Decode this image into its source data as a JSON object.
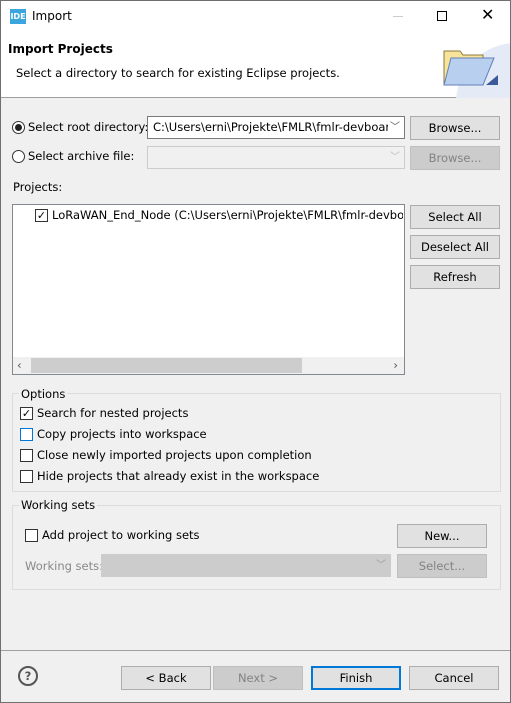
{
  "window": {
    "title": "Import",
    "app_icon": "IDE"
  },
  "header": {
    "title": "Import Projects",
    "subtitle": "Select a directory to search for existing Eclipse projects.",
    "icon": "folder-open-icon"
  },
  "source": {
    "root_label": "Select root directory:",
    "root_selected": true,
    "root_value": "C:\\Users\\erni\\Projekte\\FMLR\\fmlr-devboarc",
    "archive_label": "Select archive file:",
    "archive_value": "",
    "browse_label": "Browse...",
    "browse2_label": "Browse..."
  },
  "projects": {
    "label": "Projects:",
    "items": [
      {
        "label": "LoRaWAN_End_Node (C:\\Users\\erni\\Projekte\\FMLR\\fmlr-devboard",
        "checked": true
      }
    ],
    "select_all": "Select All",
    "deselect_all": "Deselect All",
    "refresh": "Refresh"
  },
  "options": {
    "label": "Options",
    "items": [
      {
        "label": "Search for nested projects",
        "checked": true
      },
      {
        "label": "Copy projects into workspace",
        "checked": false
      },
      {
        "label": "Close newly imported projects upon completion",
        "checked": false
      },
      {
        "label": "Hide projects that already exist in the workspace",
        "checked": false
      }
    ]
  },
  "working_sets": {
    "label": "Working sets",
    "add_label": "Add project to working sets",
    "add_checked": false,
    "new_label": "New...",
    "sets_label": "Working sets:",
    "select_label": "Select..."
  },
  "footer": {
    "back": "< Back",
    "next": "Next >",
    "finish": "Finish",
    "cancel": "Cancel"
  },
  "colors": {
    "accent": "#0078d7"
  }
}
